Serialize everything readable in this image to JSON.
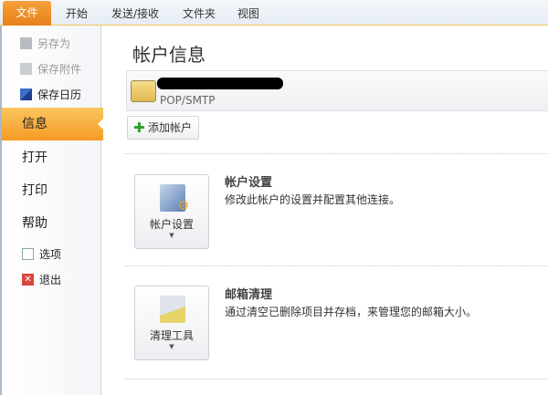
{
  "tabs": {
    "file": "文件",
    "items": [
      "开始",
      "发送/接收",
      "文件夹",
      "视图"
    ]
  },
  "sidebar": {
    "save_as": "另存为",
    "save_attachments": "保存附件",
    "save_calendar": "保存日历",
    "info": "信息",
    "open": "打开",
    "print": "打印",
    "help": "帮助",
    "options": "选项",
    "exit": "退出"
  },
  "main": {
    "title": "帐户信息",
    "account_type": "POP/SMTP",
    "add_account": "添加帐户",
    "sections": [
      {
        "button": "帐户设置",
        "heading": "帐户设置",
        "desc": "修改此帐户的设置并配置其他连接。"
      },
      {
        "button": "清理工具",
        "heading": "邮箱清理",
        "desc": "通过清空已删除项目并存档，来管理您的邮箱大小。"
      }
    ]
  },
  "colors": {
    "accent": "#f59a24"
  }
}
